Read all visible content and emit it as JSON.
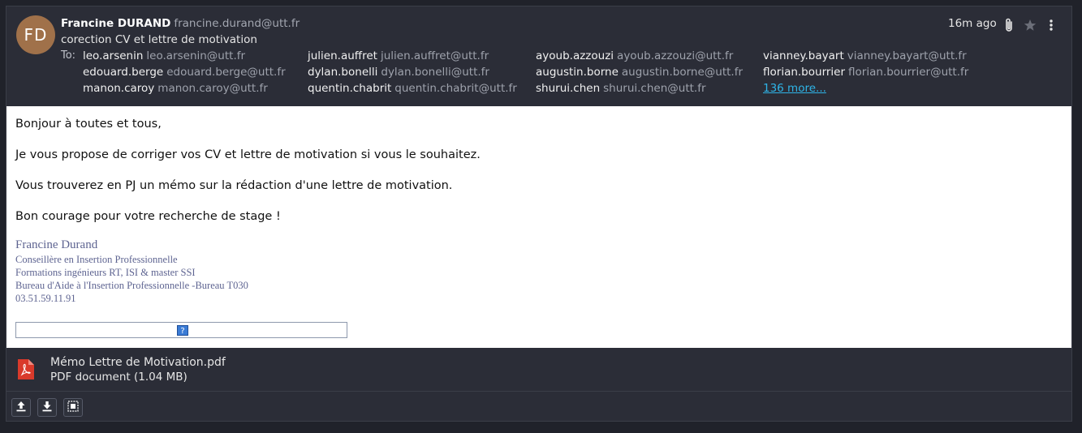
{
  "message": {
    "avatar_initials": "FD",
    "sender_name": "Francine DURAND",
    "sender_email": "francine.durand@utt.fr",
    "subject": "corection CV et lettre de motivation",
    "time": "16m ago",
    "to_label": "To:",
    "more_link": "136 more...",
    "recipients": [
      {
        "name": "leo.arsenin",
        "email": "leo.arsenin@utt.fr"
      },
      {
        "name": "julien.auffret",
        "email": "julien.auffret@utt.fr"
      },
      {
        "name": "ayoub.azzouzi",
        "email": "ayoub.azzouzi@utt.fr"
      },
      {
        "name": "vianney.bayart",
        "email": "vianney.bayart@utt.fr"
      },
      {
        "name": "edouard.berge",
        "email": "edouard.berge@utt.fr"
      },
      {
        "name": "dylan.bonelli",
        "email": "dylan.bonelli@utt.fr"
      },
      {
        "name": "augustin.borne",
        "email": "augustin.borne@utt.fr"
      },
      {
        "name": "florian.bourrier",
        "email": "florian.bourrier@utt.fr"
      },
      {
        "name": "manon.caroy",
        "email": "manon.caroy@utt.fr"
      },
      {
        "name": "quentin.chabrit",
        "email": "quentin.chabrit@utt.fr"
      },
      {
        "name": "shurui.chen",
        "email": "shurui.chen@utt.fr"
      }
    ]
  },
  "body": {
    "greeting": "Bonjour à toutes et tous,",
    "p1": "Je vous propose de corriger vos CV et lettre de motivation si vous le souhaitez.",
    "p2": "Vous trouverez en PJ un mémo sur la rédaction d'une lettre de motivation.",
    "p3": "Bon courage pour votre recherche de stage !",
    "signature": {
      "name": "Francine Durand",
      "lines": [
        "Conseillère en Insertion Professionnelle",
        "Formations ingénieurs RT, ISI & master SSI",
        "Bureau d'Aide à l'Insertion Professionnelle -Bureau T030",
        "03.51.59.11.91"
      ]
    },
    "image_placeholder_glyph": "?"
  },
  "attachment": {
    "filename": "Mémo Lettre de Motivation.pdf",
    "meta": "PDF document (1.04 MB)",
    "icon": "pdf-file-icon"
  },
  "toolbar": {
    "buttons": [
      "upload-icon",
      "download-icon",
      "select-all-icon"
    ]
  },
  "colors": {
    "background": "#20222a",
    "panel": "#2b2d37",
    "link": "#2eb5e8",
    "avatar": "#a0714a",
    "signature": "#5e6491",
    "pdf_red": "#d93a2b"
  }
}
